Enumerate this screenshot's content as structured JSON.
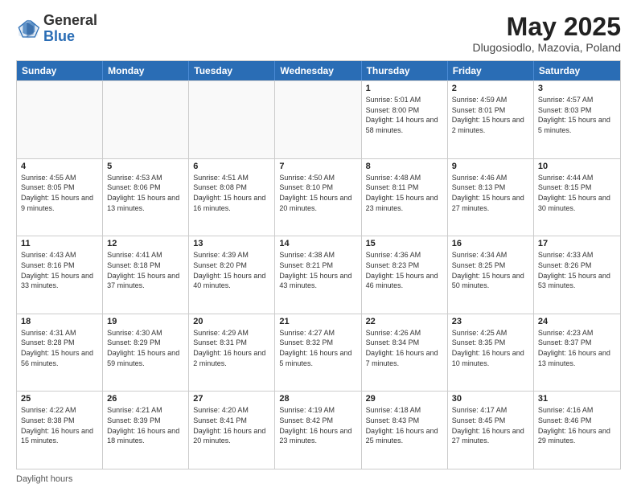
{
  "header": {
    "logo_general": "General",
    "logo_blue": "Blue",
    "main_title": "May 2025",
    "subtitle": "Dlugosiodlo, Mazovia, Poland"
  },
  "calendar": {
    "days_of_week": [
      "Sunday",
      "Monday",
      "Tuesday",
      "Wednesday",
      "Thursday",
      "Friday",
      "Saturday"
    ],
    "weeks": [
      [
        {
          "day": "",
          "info": "",
          "empty": true
        },
        {
          "day": "",
          "info": "",
          "empty": true
        },
        {
          "day": "",
          "info": "",
          "empty": true
        },
        {
          "day": "",
          "info": "",
          "empty": true
        },
        {
          "day": "1",
          "info": "Sunrise: 5:01 AM\nSunset: 8:00 PM\nDaylight: 14 hours and 58 minutes.",
          "empty": false
        },
        {
          "day": "2",
          "info": "Sunrise: 4:59 AM\nSunset: 8:01 PM\nDaylight: 15 hours and 2 minutes.",
          "empty": false
        },
        {
          "day": "3",
          "info": "Sunrise: 4:57 AM\nSunset: 8:03 PM\nDaylight: 15 hours and 5 minutes.",
          "empty": false
        }
      ],
      [
        {
          "day": "4",
          "info": "Sunrise: 4:55 AM\nSunset: 8:05 PM\nDaylight: 15 hours and 9 minutes.",
          "empty": false
        },
        {
          "day": "5",
          "info": "Sunrise: 4:53 AM\nSunset: 8:06 PM\nDaylight: 15 hours and 13 minutes.",
          "empty": false
        },
        {
          "day": "6",
          "info": "Sunrise: 4:51 AM\nSunset: 8:08 PM\nDaylight: 15 hours and 16 minutes.",
          "empty": false
        },
        {
          "day": "7",
          "info": "Sunrise: 4:50 AM\nSunset: 8:10 PM\nDaylight: 15 hours and 20 minutes.",
          "empty": false
        },
        {
          "day": "8",
          "info": "Sunrise: 4:48 AM\nSunset: 8:11 PM\nDaylight: 15 hours and 23 minutes.",
          "empty": false
        },
        {
          "day": "9",
          "info": "Sunrise: 4:46 AM\nSunset: 8:13 PM\nDaylight: 15 hours and 27 minutes.",
          "empty": false
        },
        {
          "day": "10",
          "info": "Sunrise: 4:44 AM\nSunset: 8:15 PM\nDaylight: 15 hours and 30 minutes.",
          "empty": false
        }
      ],
      [
        {
          "day": "11",
          "info": "Sunrise: 4:43 AM\nSunset: 8:16 PM\nDaylight: 15 hours and 33 minutes.",
          "empty": false
        },
        {
          "day": "12",
          "info": "Sunrise: 4:41 AM\nSunset: 8:18 PM\nDaylight: 15 hours and 37 minutes.",
          "empty": false
        },
        {
          "day": "13",
          "info": "Sunrise: 4:39 AM\nSunset: 8:20 PM\nDaylight: 15 hours and 40 minutes.",
          "empty": false
        },
        {
          "day": "14",
          "info": "Sunrise: 4:38 AM\nSunset: 8:21 PM\nDaylight: 15 hours and 43 minutes.",
          "empty": false
        },
        {
          "day": "15",
          "info": "Sunrise: 4:36 AM\nSunset: 8:23 PM\nDaylight: 15 hours and 46 minutes.",
          "empty": false
        },
        {
          "day": "16",
          "info": "Sunrise: 4:34 AM\nSunset: 8:25 PM\nDaylight: 15 hours and 50 minutes.",
          "empty": false
        },
        {
          "day": "17",
          "info": "Sunrise: 4:33 AM\nSunset: 8:26 PM\nDaylight: 15 hours and 53 minutes.",
          "empty": false
        }
      ],
      [
        {
          "day": "18",
          "info": "Sunrise: 4:31 AM\nSunset: 8:28 PM\nDaylight: 15 hours and 56 minutes.",
          "empty": false
        },
        {
          "day": "19",
          "info": "Sunrise: 4:30 AM\nSunset: 8:29 PM\nDaylight: 15 hours and 59 minutes.",
          "empty": false
        },
        {
          "day": "20",
          "info": "Sunrise: 4:29 AM\nSunset: 8:31 PM\nDaylight: 16 hours and 2 minutes.",
          "empty": false
        },
        {
          "day": "21",
          "info": "Sunrise: 4:27 AM\nSunset: 8:32 PM\nDaylight: 16 hours and 5 minutes.",
          "empty": false
        },
        {
          "day": "22",
          "info": "Sunrise: 4:26 AM\nSunset: 8:34 PM\nDaylight: 16 hours and 7 minutes.",
          "empty": false
        },
        {
          "day": "23",
          "info": "Sunrise: 4:25 AM\nSunset: 8:35 PM\nDaylight: 16 hours and 10 minutes.",
          "empty": false
        },
        {
          "day": "24",
          "info": "Sunrise: 4:23 AM\nSunset: 8:37 PM\nDaylight: 16 hours and 13 minutes.",
          "empty": false
        }
      ],
      [
        {
          "day": "25",
          "info": "Sunrise: 4:22 AM\nSunset: 8:38 PM\nDaylight: 16 hours and 15 minutes.",
          "empty": false
        },
        {
          "day": "26",
          "info": "Sunrise: 4:21 AM\nSunset: 8:39 PM\nDaylight: 16 hours and 18 minutes.",
          "empty": false
        },
        {
          "day": "27",
          "info": "Sunrise: 4:20 AM\nSunset: 8:41 PM\nDaylight: 16 hours and 20 minutes.",
          "empty": false
        },
        {
          "day": "28",
          "info": "Sunrise: 4:19 AM\nSunset: 8:42 PM\nDaylight: 16 hours and 23 minutes.",
          "empty": false
        },
        {
          "day": "29",
          "info": "Sunrise: 4:18 AM\nSunset: 8:43 PM\nDaylight: 16 hours and 25 minutes.",
          "empty": false
        },
        {
          "day": "30",
          "info": "Sunrise: 4:17 AM\nSunset: 8:45 PM\nDaylight: 16 hours and 27 minutes.",
          "empty": false
        },
        {
          "day": "31",
          "info": "Sunrise: 4:16 AM\nSunset: 8:46 PM\nDaylight: 16 hours and 29 minutes.",
          "empty": false
        }
      ]
    ]
  },
  "footer": {
    "label": "Daylight hours"
  }
}
